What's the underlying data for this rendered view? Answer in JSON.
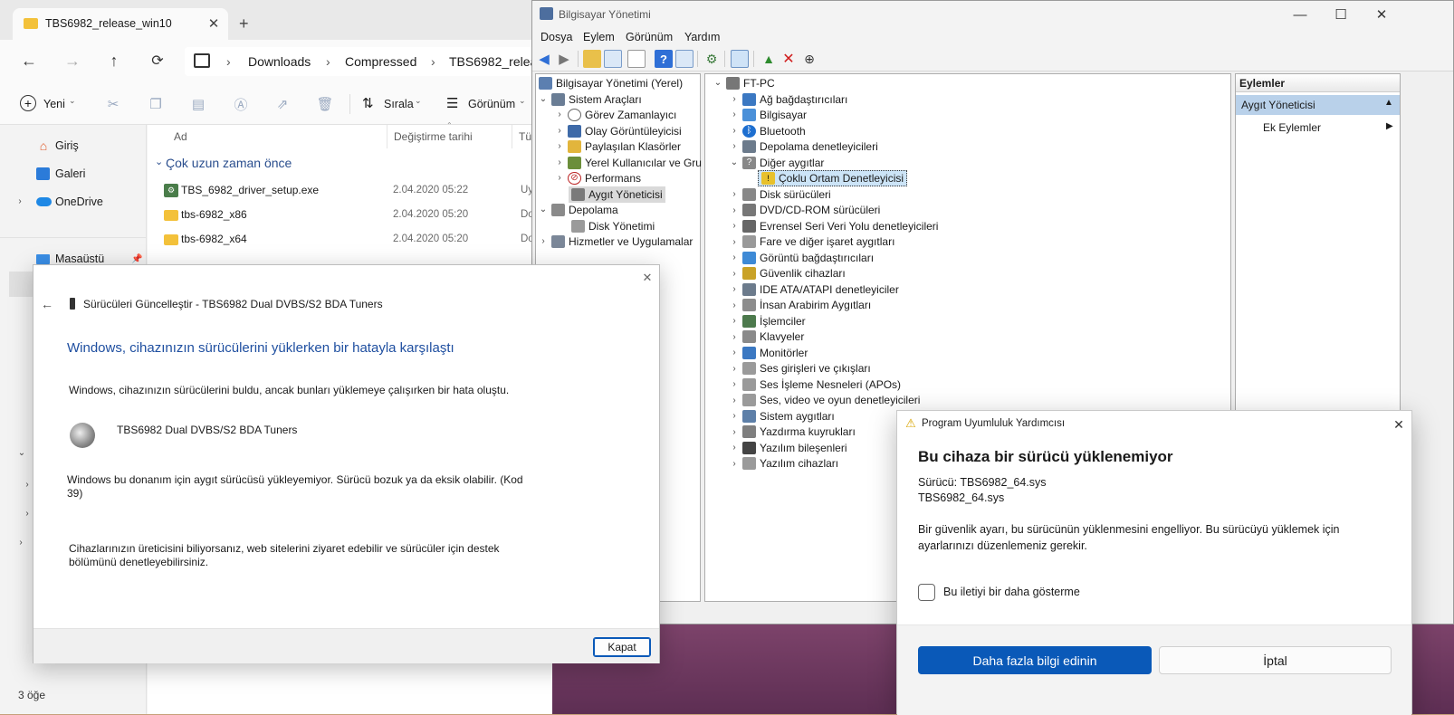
{
  "explorer": {
    "tab_title": "TBS6982_release_win10",
    "breadcrumb": [
      "Downloads",
      "Compressed",
      "TBS6982_releas"
    ],
    "toolbar": {
      "new_label": "Yeni",
      "sort_label": "Sırala",
      "view_label": "Görünüm"
    },
    "nav_items": [
      {
        "label": "Giriş",
        "icon": "home-icon"
      },
      {
        "label": "Galeri",
        "icon": "gallery-icon"
      },
      {
        "label": "OneDrive",
        "icon": "onedrive-icon"
      },
      {
        "label": "Masaüstü",
        "icon": "desktop-icon"
      }
    ],
    "columns": {
      "name": "Ad",
      "modified": "Değiştirme tarihi",
      "type": "Tü"
    },
    "group_header": "Çok uzun zaman önce",
    "files": [
      {
        "name": "TBS_6982_driver_setup.exe",
        "date": "2.04.2020 05:22",
        "type": "Uy",
        "icon": "setup-icon"
      },
      {
        "name": "tbs-6982_x86",
        "date": "2.04.2020 05:20",
        "type": "Do",
        "icon": "folder-icon"
      },
      {
        "name": "tbs-6982_x64",
        "date": "2.04.2020 05:20",
        "type": "Do",
        "icon": "folder-icon"
      }
    ],
    "status": "3 öğe"
  },
  "compmgmt": {
    "title": "Bilgisayar Yönetimi",
    "menu": [
      "Dosya",
      "Eylem",
      "Görünüm",
      "Yardım"
    ],
    "tree": {
      "root": "Bilgisayar Yönetimi (Yerel)",
      "system_tools": "Sistem Araçları",
      "system_children": [
        "Görev Zamanlayıcı",
        "Olay Görüntüleyicisi",
        "Paylaşılan Klasörler",
        "Yerel Kullanıcılar ve Gru",
        "Performans",
        "Aygıt Yöneticisi"
      ],
      "storage": "Depolama",
      "storage_children": [
        "Disk Yönetimi"
      ],
      "services": "Hizmetler ve Uygulamalar"
    },
    "devices": {
      "root": "FT-PC",
      "categories": [
        "Ağ bağdaştırıcıları",
        "Bilgisayar",
        "Bluetooth",
        "Depolama denetleyicileri",
        "Diğer aygıtlar"
      ],
      "other_child": "Çoklu Ortam Denetleyicisi",
      "categories2": [
        "Disk sürücüleri",
        "DVD/CD-ROM sürücüleri",
        "Evrensel Seri Veri Yolu denetleyicileri",
        "Fare ve diğer işaret aygıtları",
        "Görüntü bağdaştırıcıları",
        "Güvenlik cihazları",
        "IDE ATA/ATAPI denetleyiciler",
        "İnsan Arabirim Aygıtları",
        "İşlemciler",
        "Klavyeler",
        "Monitörler",
        "Ses girişleri ve çıkışları",
        "Ses İşleme Nesneleri (APOs)",
        "Ses, video ve oyun denetleyicileri",
        "Sistem aygıtları",
        "Yazdırma kuyrukları",
        "Yazılım bileşenleri",
        "Yazılım cihazları"
      ]
    },
    "actions": {
      "header": "Eylemler",
      "section": "Aygıt Yöneticisi",
      "more": "Ek Eylemler"
    }
  },
  "driver_dialog": {
    "title": "Sürücüleri Güncelleştir - TBS6982 Dual DVBS/S2 BDA Tuners",
    "heading": "Windows, cihazınızın sürücülerini yüklerken bir hatayla karşılaştı",
    "line1": "Windows, cihazınızın sürücülerini buldu, ancak bunları yüklemeye çalışırken bir hata oluştu.",
    "device_name": "TBS6982 Dual DVBS/S2 BDA Tuners",
    "error_line1": "Windows bu donanım için aygıt sürücüsü yükleyemiyor. Sürücü bozuk ya da eksik olabilir. (Kod",
    "error_line2": "39)",
    "help_line1": "Cihazlarınızın üreticisini biliyorsanız, web sitelerini ziyaret edebilir ve sürücüler için destek",
    "help_line2": "bölümünü denetleyebilirsiniz.",
    "close_label": "Kapat"
  },
  "pca_dialog": {
    "title": "Program Uyumluluk Yardımcısı",
    "heading": "Bu cihaza bir sürücü yüklenemiyor",
    "driver_line": "Sürücü: TBS6982_64.sys",
    "driver_file": "TBS6982_64.sys",
    "body_line1": "Bir güvenlik ayarı, bu sürücünün yüklenmesini engelliyor. Bu sürücüyü yüklemek için",
    "body_line2": "ayarlarınızı düzenlemeniz gerekir.",
    "checkbox_label": "Bu iletiyi bir daha gösterme",
    "primary_label": "Daha fazla bilgi edinin",
    "cancel_label": "İptal"
  },
  "colors": {
    "accent": "#0a59b8",
    "heading_blue": "#1f4fa0",
    "folder": "#f3c13a"
  }
}
